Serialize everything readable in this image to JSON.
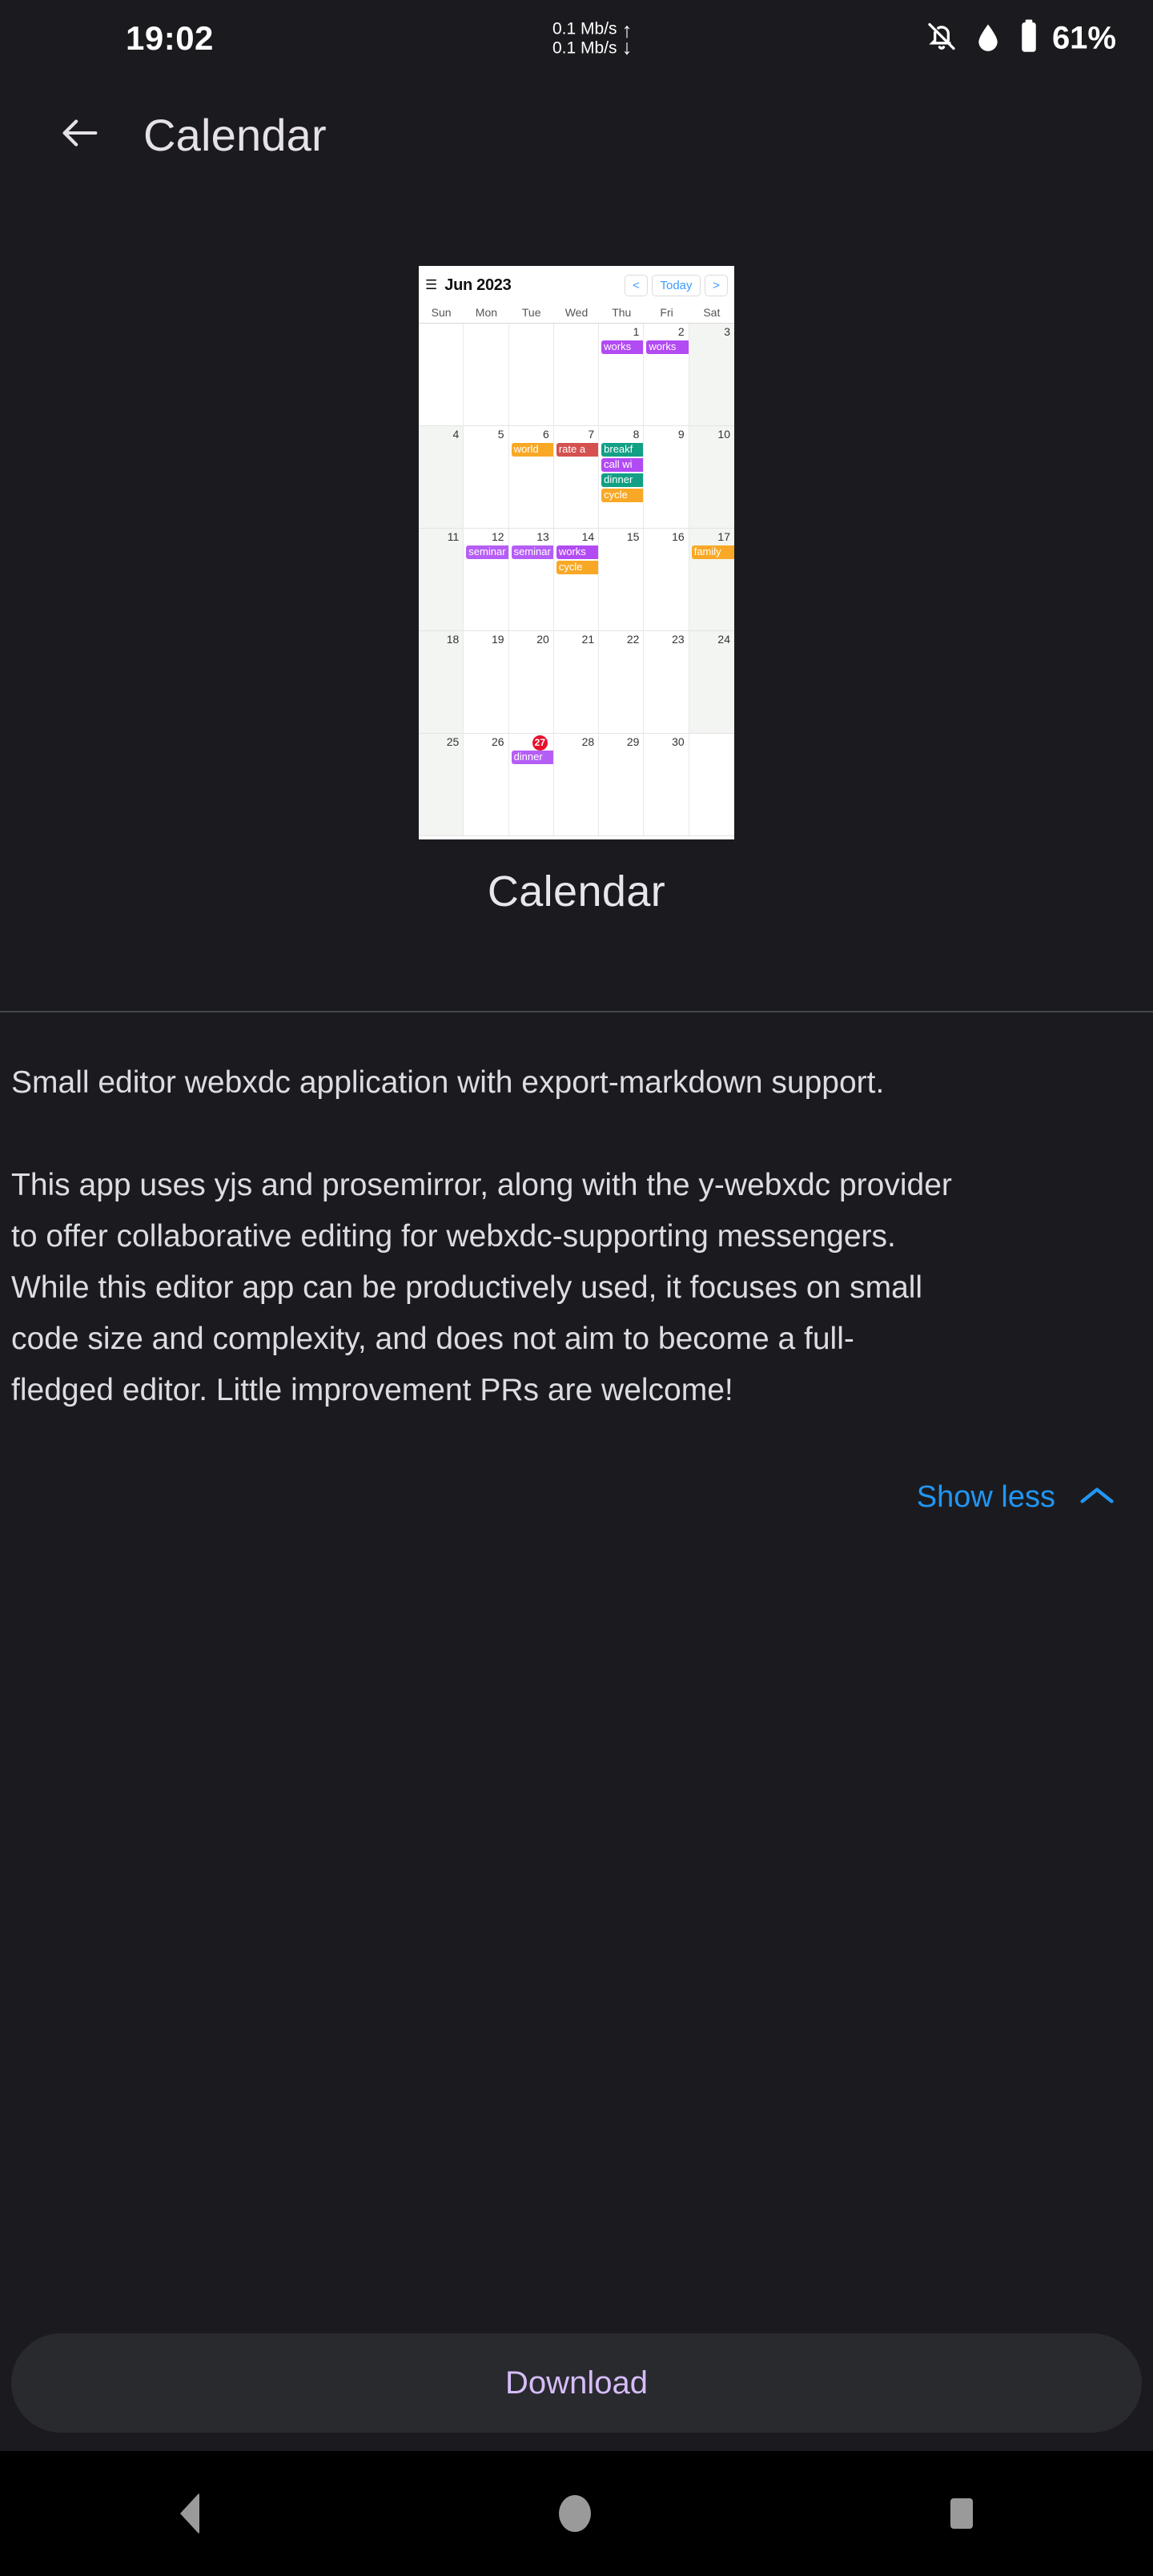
{
  "statusbar": {
    "time": "19:02",
    "net_up": "0.1 Mb/s",
    "net_down": "0.1 Mb/s",
    "up_arrow": "⬆",
    "down_arrow": "⬇",
    "icons": [
      "notifications-off-icon",
      "cloud-icon",
      "battery-icon"
    ],
    "battery": "61%"
  },
  "appbar": {
    "back_icon": "arrow-left-icon",
    "title": "Calendar"
  },
  "preview": {
    "app_title": "Calendar",
    "calendar": {
      "menu_icon": "hamburger-icon",
      "month_label": "Jun 2023",
      "prev_label": "<",
      "today_label": "Today",
      "next_label": ">",
      "weekdays": [
        "Sun",
        "Mon",
        "Tue",
        "Wed",
        "Thu",
        "Fri",
        "Sat"
      ],
      "today_date": 27,
      "cells": [
        {
          "day": "",
          "weekend": false,
          "events": []
        },
        {
          "day": "",
          "weekend": false,
          "events": []
        },
        {
          "day": "",
          "weekend": false,
          "events": []
        },
        {
          "day": "",
          "weekend": false,
          "events": []
        },
        {
          "day": "1",
          "weekend": false,
          "events": [
            {
              "label": "works",
              "color": "#b24bf3"
            }
          ]
        },
        {
          "day": "2",
          "weekend": false,
          "events": [
            {
              "label": "works",
              "color": "#b24bf3"
            }
          ]
        },
        {
          "day": "3",
          "weekend": true,
          "events": []
        },
        {
          "day": "4",
          "weekend": true,
          "events": []
        },
        {
          "day": "5",
          "weekend": false,
          "events": []
        },
        {
          "day": "6",
          "weekend": false,
          "events": [
            {
              "label": "world",
              "color": "#f9a825"
            }
          ]
        },
        {
          "day": "7",
          "weekend": false,
          "events": [
            {
              "label": "rate a",
              "color": "#d4514f"
            }
          ]
        },
        {
          "day": "8",
          "weekend": false,
          "events": [
            {
              "label": "breakf",
              "color": "#13a085"
            },
            {
              "label": "call wi",
              "color": "#b24bf3"
            },
            {
              "label": "dinner",
              "color": "#13a085"
            },
            {
              "label": "cycle",
              "color": "#f9a825"
            }
          ]
        },
        {
          "day": "9",
          "weekend": false,
          "events": []
        },
        {
          "day": "10",
          "weekend": true,
          "events": []
        },
        {
          "day": "11",
          "weekend": true,
          "events": []
        },
        {
          "day": "12",
          "weekend": false,
          "events": [
            {
              "label": "seminar",
              "color": "#b55ef5"
            }
          ]
        },
        {
          "day": "13",
          "weekend": false,
          "events": [
            {
              "label": "seminar",
              "color": "#b55ef5"
            }
          ]
        },
        {
          "day": "14",
          "weekend": false,
          "events": [
            {
              "label": "works",
              "color": "#b24bf3"
            },
            {
              "label": "cycle",
              "color": "#f9a825"
            }
          ]
        },
        {
          "day": "15",
          "weekend": false,
          "events": []
        },
        {
          "day": "16",
          "weekend": false,
          "events": []
        },
        {
          "day": "17",
          "weekend": true,
          "events": [
            {
              "label": "family",
              "color": "#f9a825"
            }
          ]
        },
        {
          "day": "18",
          "weekend": true,
          "events": []
        },
        {
          "day": "19",
          "weekend": false,
          "events": []
        },
        {
          "day": "20",
          "weekend": false,
          "events": []
        },
        {
          "day": "21",
          "weekend": false,
          "events": []
        },
        {
          "day": "22",
          "weekend": false,
          "events": []
        },
        {
          "day": "23",
          "weekend": false,
          "events": []
        },
        {
          "day": "24",
          "weekend": true,
          "events": []
        },
        {
          "day": "25",
          "weekend": true,
          "events": []
        },
        {
          "day": "26",
          "weekend": false,
          "events": []
        },
        {
          "day": "27",
          "weekend": false,
          "today": true,
          "events": [
            {
              "label": "dinner",
              "color": "#b55ef5"
            }
          ]
        },
        {
          "day": "28",
          "weekend": false,
          "events": []
        },
        {
          "day": "29",
          "weekend": false,
          "events": []
        },
        {
          "day": "30",
          "weekend": false,
          "events": []
        },
        {
          "day": "",
          "weekend": false,
          "events": []
        }
      ]
    }
  },
  "description": {
    "paragraph1": "Small editor webxdc application with export-markdown support.",
    "paragraph2_line1": "This app uses yjs and prosemirror, along with the y-webxdc provider",
    "paragraph2_line2": "to offer collaborative editing for webxdc-supporting messengers.",
    "paragraph2_line3": "While this editor app can be productively used, it focuses on small",
    "paragraph2_line4": "code size and complexity, and does not aim to become a full-",
    "paragraph2_line5": "fledged editor. Little improvement PRs are welcome!",
    "toggle_label": "Show less",
    "toggle_icon": "chevron-up-icon",
    "toggle_color": "#2196f3"
  },
  "actions": {
    "download_label": "Download",
    "download_color": "#d6bcfa"
  },
  "navbar": {
    "back": "nav-back-icon",
    "home": "nav-home-icon",
    "recents": "nav-recents-icon"
  }
}
